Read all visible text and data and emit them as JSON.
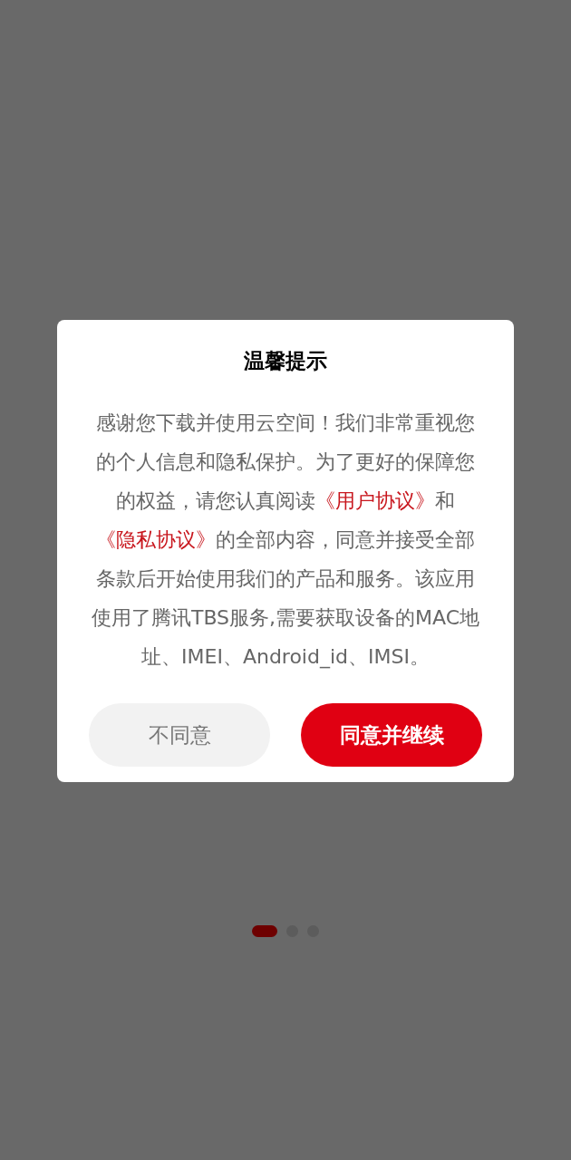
{
  "pager": {
    "dots": [
      {
        "selected": true
      },
      {
        "selected": false
      },
      {
        "selected": false
      }
    ]
  },
  "dialog": {
    "title": "温馨提示",
    "message": [
      {
        "kind": "text",
        "text": "感谢您下载并使用云空间！我们非常重视您的个人信息和隐私保护。为了更好的保障您的权益，请您认真阅读"
      },
      {
        "kind": "link",
        "text": "《用户协议》"
      },
      {
        "kind": "text",
        "text": "和"
      },
      {
        "kind": "link",
        "text": "《隐私协议》"
      },
      {
        "kind": "text",
        "text": "的全部内容，同意并接受全部条款后开始使用我们的产品和服务。该应用使用了腾讯TBS服务,需要获取设备的MAC地址、IMEI、Android_id、IMSI。"
      }
    ],
    "buttons": [
      {
        "kind": "secondary",
        "label": "不同意"
      },
      {
        "kind": "primary",
        "label": "同意并继续"
      }
    ]
  }
}
